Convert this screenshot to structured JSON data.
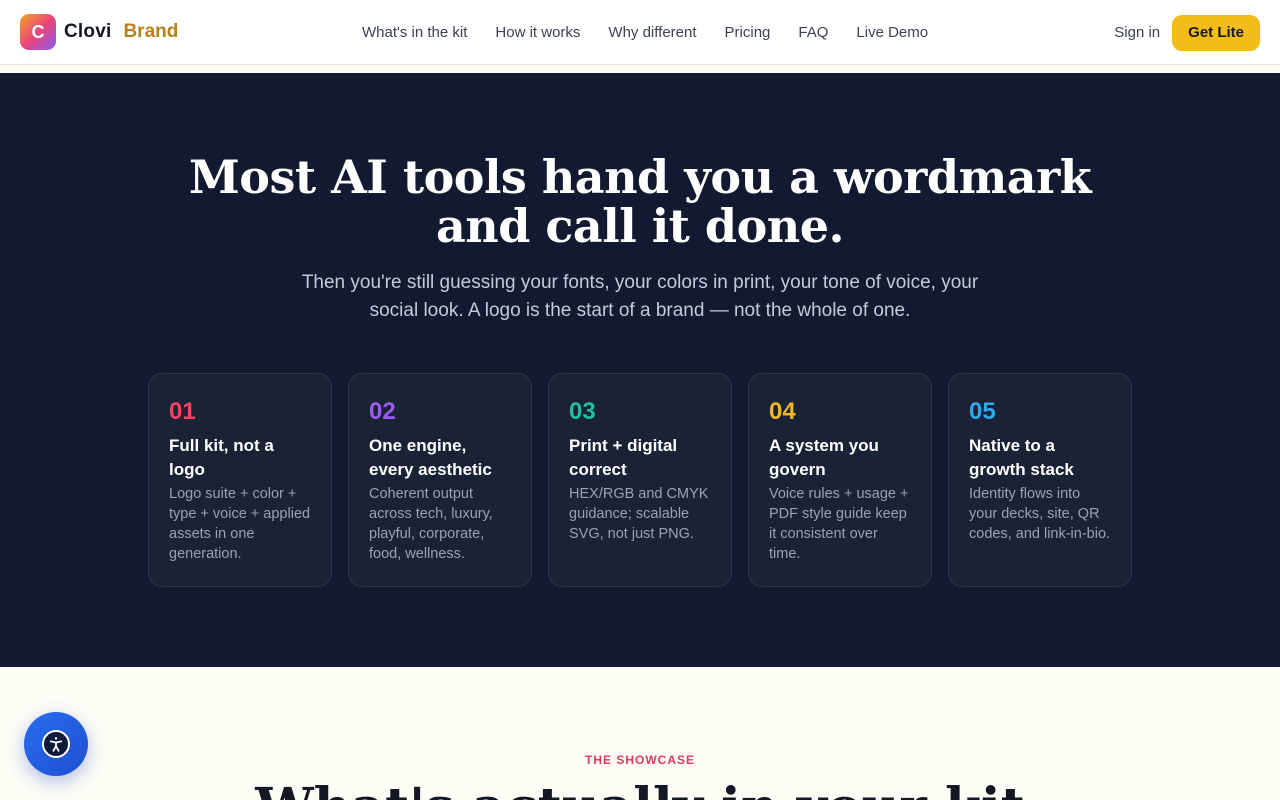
{
  "brand": {
    "mark": "C",
    "name": "Clovi",
    "accent": "Brand"
  },
  "nav": [
    {
      "label": "What's in the kit"
    },
    {
      "label": "How it works"
    },
    {
      "label": "Why different"
    },
    {
      "label": "Pricing"
    },
    {
      "label": "FAQ"
    },
    {
      "label": "Live Demo"
    }
  ],
  "header": {
    "signin": "Sign in",
    "cta": "Get Lite"
  },
  "hero": {
    "headline": "Most AI tools hand you a wordmark and call it done.",
    "subhead": "Then you're still guessing your fonts, your colors in print, your tone of voice, your social look. A logo is the start of a brand — not the whole of one."
  },
  "cards": [
    {
      "num": "01",
      "color": "#f0445f",
      "title": "Full kit, not a logo",
      "desc": "Logo suite + color + type + voice + applied assets in one generation."
    },
    {
      "num": "02",
      "color": "#9b5cf6",
      "title": "One engine, every aesthetic",
      "desc": "Coherent output across tech, luxury, playful, corporate, food, wellness."
    },
    {
      "num": "03",
      "color": "#1fbfa0",
      "title": "Print + digital correct",
      "desc": "HEX/RGB and CMYK guidance; scalable SVG, not just PNG."
    },
    {
      "num": "04",
      "color": "#f2b61e",
      "title": "A system you govern",
      "desc": "Voice rules + usage + PDF style guide keep it consistent over time."
    },
    {
      "num": "05",
      "color": "#2fa8ee",
      "title": "Native to a growth stack",
      "desc": "Identity flows into your decks, site, QR codes, and link-in-bio."
    }
  ],
  "showcase": {
    "eyebrow": "THE SHOWCASE",
    "title": "What's actually in your kit"
  },
  "accessibility": {
    "icon": "accessibility-icon"
  }
}
